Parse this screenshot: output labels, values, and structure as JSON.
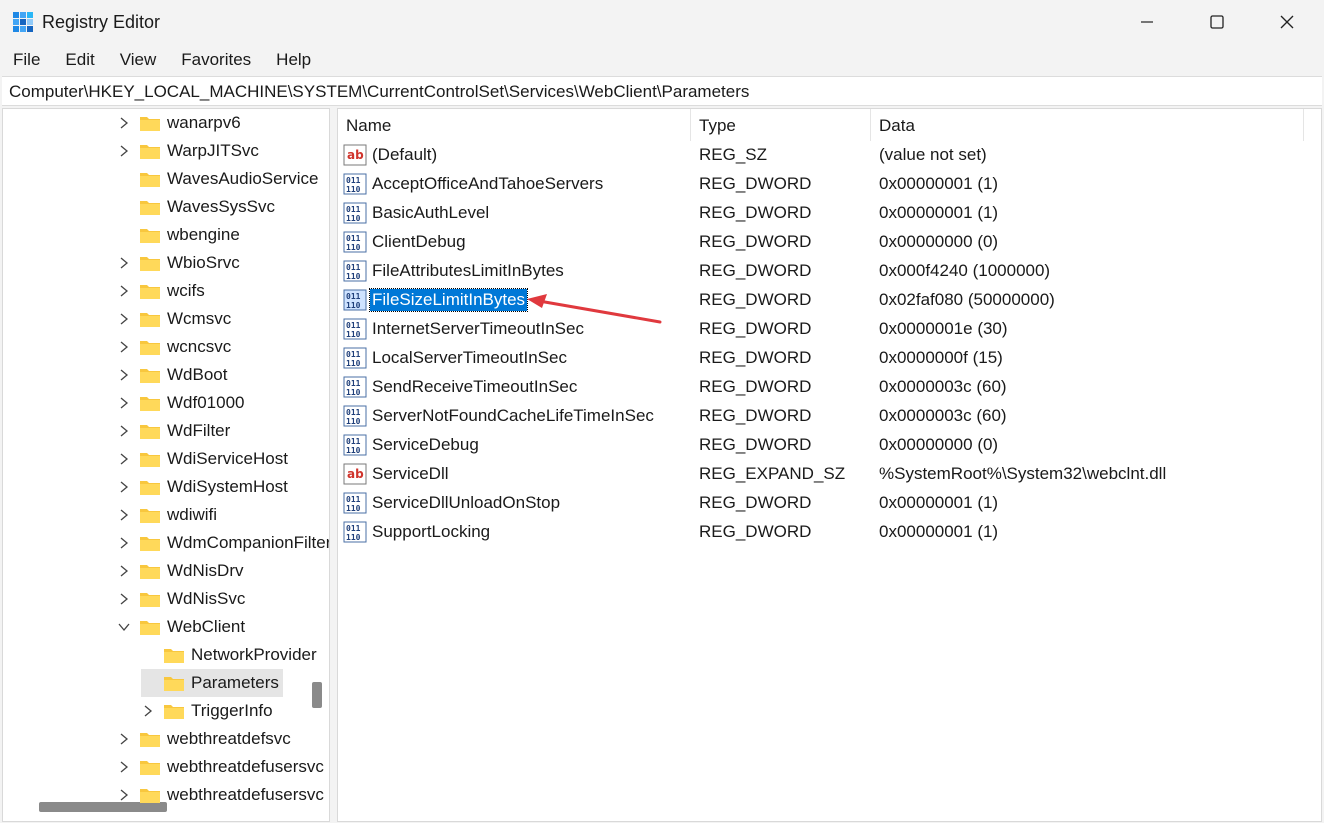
{
  "window": {
    "title": "Registry Editor",
    "icon": "registry-icon",
    "controls": [
      "minimize-icon",
      "maximize-icon",
      "close-icon"
    ]
  },
  "menu": {
    "items": [
      "File",
      "Edit",
      "View",
      "Favorites",
      "Help"
    ]
  },
  "address": {
    "path": "Computer\\HKEY_LOCAL_MACHINE\\SYSTEM\\CurrentControlSet\\Services\\WebClient\\Parameters"
  },
  "tree": {
    "items": [
      {
        "label": "wanarpv6",
        "expander": "collapsed",
        "level": 1
      },
      {
        "label": "WarpJITSvc",
        "expander": "collapsed",
        "level": 1
      },
      {
        "label": "WavesAudioService",
        "expander": "none",
        "level": 1
      },
      {
        "label": "WavesSysSvc",
        "expander": "none",
        "level": 1
      },
      {
        "label": "wbengine",
        "expander": "none",
        "level": 1
      },
      {
        "label": "WbioSrvc",
        "expander": "collapsed",
        "level": 1
      },
      {
        "label": "wcifs",
        "expander": "collapsed",
        "level": 1
      },
      {
        "label": "Wcmsvc",
        "expander": "collapsed",
        "level": 1
      },
      {
        "label": "wcncsvc",
        "expander": "collapsed",
        "level": 1
      },
      {
        "label": "WdBoot",
        "expander": "collapsed",
        "level": 1
      },
      {
        "label": "Wdf01000",
        "expander": "collapsed",
        "level": 1
      },
      {
        "label": "WdFilter",
        "expander": "collapsed",
        "level": 1
      },
      {
        "label": "WdiServiceHost",
        "expander": "collapsed",
        "level": 1
      },
      {
        "label": "WdiSystemHost",
        "expander": "collapsed",
        "level": 1
      },
      {
        "label": "wdiwifi",
        "expander": "collapsed",
        "level": 1
      },
      {
        "label": "WdmCompanionFilter",
        "expander": "collapsed",
        "level": 1
      },
      {
        "label": "WdNisDrv",
        "expander": "collapsed",
        "level": 1
      },
      {
        "label": "WdNisSvc",
        "expander": "collapsed",
        "level": 1
      },
      {
        "label": "WebClient",
        "expander": "expanded",
        "level": 1
      },
      {
        "label": "NetworkProvider",
        "expander": "none",
        "level": 2
      },
      {
        "label": "Parameters",
        "expander": "none",
        "level": 2,
        "selected": true
      },
      {
        "label": "TriggerInfo",
        "expander": "collapsed",
        "level": 2
      },
      {
        "label": "webthreatdefsvc",
        "expander": "collapsed",
        "level": 1
      },
      {
        "label": "webthreatdefusersvc",
        "expander": "collapsed",
        "level": 1
      },
      {
        "label": "webthreatdefusersvc",
        "expander": "collapsed",
        "level": 1
      }
    ]
  },
  "values": {
    "columns": {
      "name": "Name",
      "type": "Type",
      "data": "Data"
    },
    "rows": [
      {
        "name": "(Default)",
        "type": "REG_SZ",
        "data": "(value not set)",
        "icon": "string-value-icon"
      },
      {
        "name": "AcceptOfficeAndTahoeServers",
        "type": "REG_DWORD",
        "data": "0x00000001 (1)",
        "icon": "binary-value-icon"
      },
      {
        "name": "BasicAuthLevel",
        "type": "REG_DWORD",
        "data": "0x00000001 (1)",
        "icon": "binary-value-icon"
      },
      {
        "name": "ClientDebug",
        "type": "REG_DWORD",
        "data": "0x00000000 (0)",
        "icon": "binary-value-icon"
      },
      {
        "name": "FileAttributesLimitInBytes",
        "type": "REG_DWORD",
        "data": "0x000f4240 (1000000)",
        "icon": "binary-value-icon"
      },
      {
        "name": "FileSizeLimitInBytes",
        "type": "REG_DWORD",
        "data": "0x02faf080 (50000000)",
        "icon": "binary-value-icon",
        "selected": true
      },
      {
        "name": "InternetServerTimeoutInSec",
        "type": "REG_DWORD",
        "data": "0x0000001e (30)",
        "icon": "binary-value-icon"
      },
      {
        "name": "LocalServerTimeoutInSec",
        "type": "REG_DWORD",
        "data": "0x0000000f (15)",
        "icon": "binary-value-icon"
      },
      {
        "name": "SendReceiveTimeoutInSec",
        "type": "REG_DWORD",
        "data": "0x0000003c (60)",
        "icon": "binary-value-icon"
      },
      {
        "name": "ServerNotFoundCacheLifeTimeInSec",
        "type": "REG_DWORD",
        "data": "0x0000003c (60)",
        "icon": "binary-value-icon"
      },
      {
        "name": "ServiceDebug",
        "type": "REG_DWORD",
        "data": "0x00000000 (0)",
        "icon": "binary-value-icon"
      },
      {
        "name": "ServiceDll",
        "type": "REG_EXPAND_SZ",
        "data": "%SystemRoot%\\System32\\webclnt.dll",
        "icon": "string-value-icon"
      },
      {
        "name": "ServiceDllUnloadOnStop",
        "type": "REG_DWORD",
        "data": "0x00000001 (1)",
        "icon": "binary-value-icon"
      },
      {
        "name": "SupportLocking",
        "type": "REG_DWORD",
        "data": "0x00000001 (1)",
        "icon": "binary-value-icon"
      }
    ]
  },
  "colors": {
    "selection": "#0078d7",
    "annotation_arrow": "#e0393e",
    "folder": "#f8c73e"
  }
}
